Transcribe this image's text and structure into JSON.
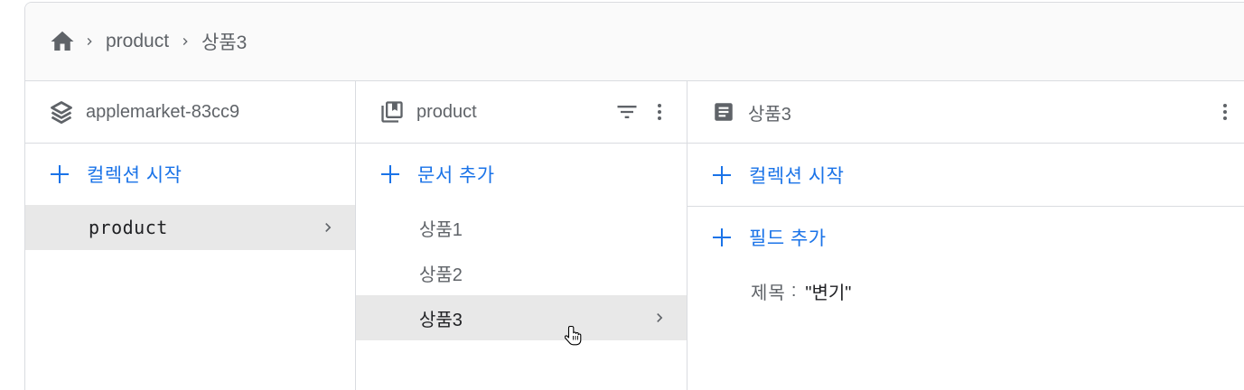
{
  "breadcrumb": {
    "home_icon": "home-icon",
    "items": [
      "product",
      "상품3"
    ]
  },
  "panels": {
    "root": {
      "title": "applemarket-83cc9",
      "icon": "firestore-stack-icon",
      "add_label": "컬렉션 시작",
      "items": [
        {
          "label": "product",
          "selected": true
        }
      ]
    },
    "collection": {
      "title": "product",
      "icon": "collection-icon",
      "add_label": "문서 추가",
      "items": [
        {
          "label": "상품1",
          "selected": false
        },
        {
          "label": "상품2",
          "selected": false
        },
        {
          "label": "상품3",
          "selected": true
        }
      ]
    },
    "document": {
      "title": "상품3",
      "icon": "document-icon",
      "add_collection_label": "컬렉션 시작",
      "add_field_label": "필드 추가",
      "fields": [
        {
          "key": "제목",
          "value": "\"변기\""
        }
      ]
    }
  },
  "colors": {
    "accent": "#1a73e8",
    "selected_bg": "#e8e8e8",
    "border": "#dadce0",
    "text_muted": "#5f6368"
  }
}
